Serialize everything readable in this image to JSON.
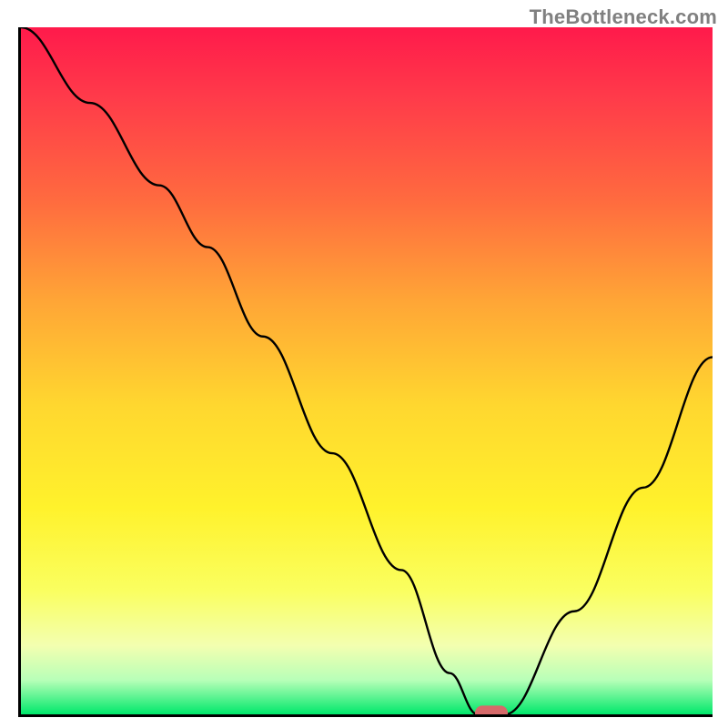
{
  "watermark": "TheBottleneck.com",
  "chart_data": {
    "type": "line",
    "title": "",
    "xlabel": "",
    "ylabel": "",
    "xlim": [
      0,
      100
    ],
    "ylim": [
      0,
      100
    ],
    "grid": false,
    "legend": false,
    "background_gradient": {
      "top": "#ff1a4b",
      "bottom": "#00e86b",
      "stops": [
        "#ff1a4b",
        "#ff6a3f",
        "#ffd72f",
        "#faff60",
        "#00e86b"
      ]
    },
    "series": [
      {
        "name": "bottleneck-curve",
        "color": "#000000",
        "x": [
          0,
          10,
          20,
          27,
          35,
          45,
          55,
          62,
          66,
          70,
          80,
          90,
          100
        ],
        "values": [
          100,
          89,
          77,
          68,
          55,
          38,
          21,
          6,
          0,
          0,
          15,
          33,
          52
        ]
      }
    ],
    "marker": {
      "name": "optimal-point",
      "x": 68,
      "y": 0,
      "color": "#d66a6a"
    }
  }
}
